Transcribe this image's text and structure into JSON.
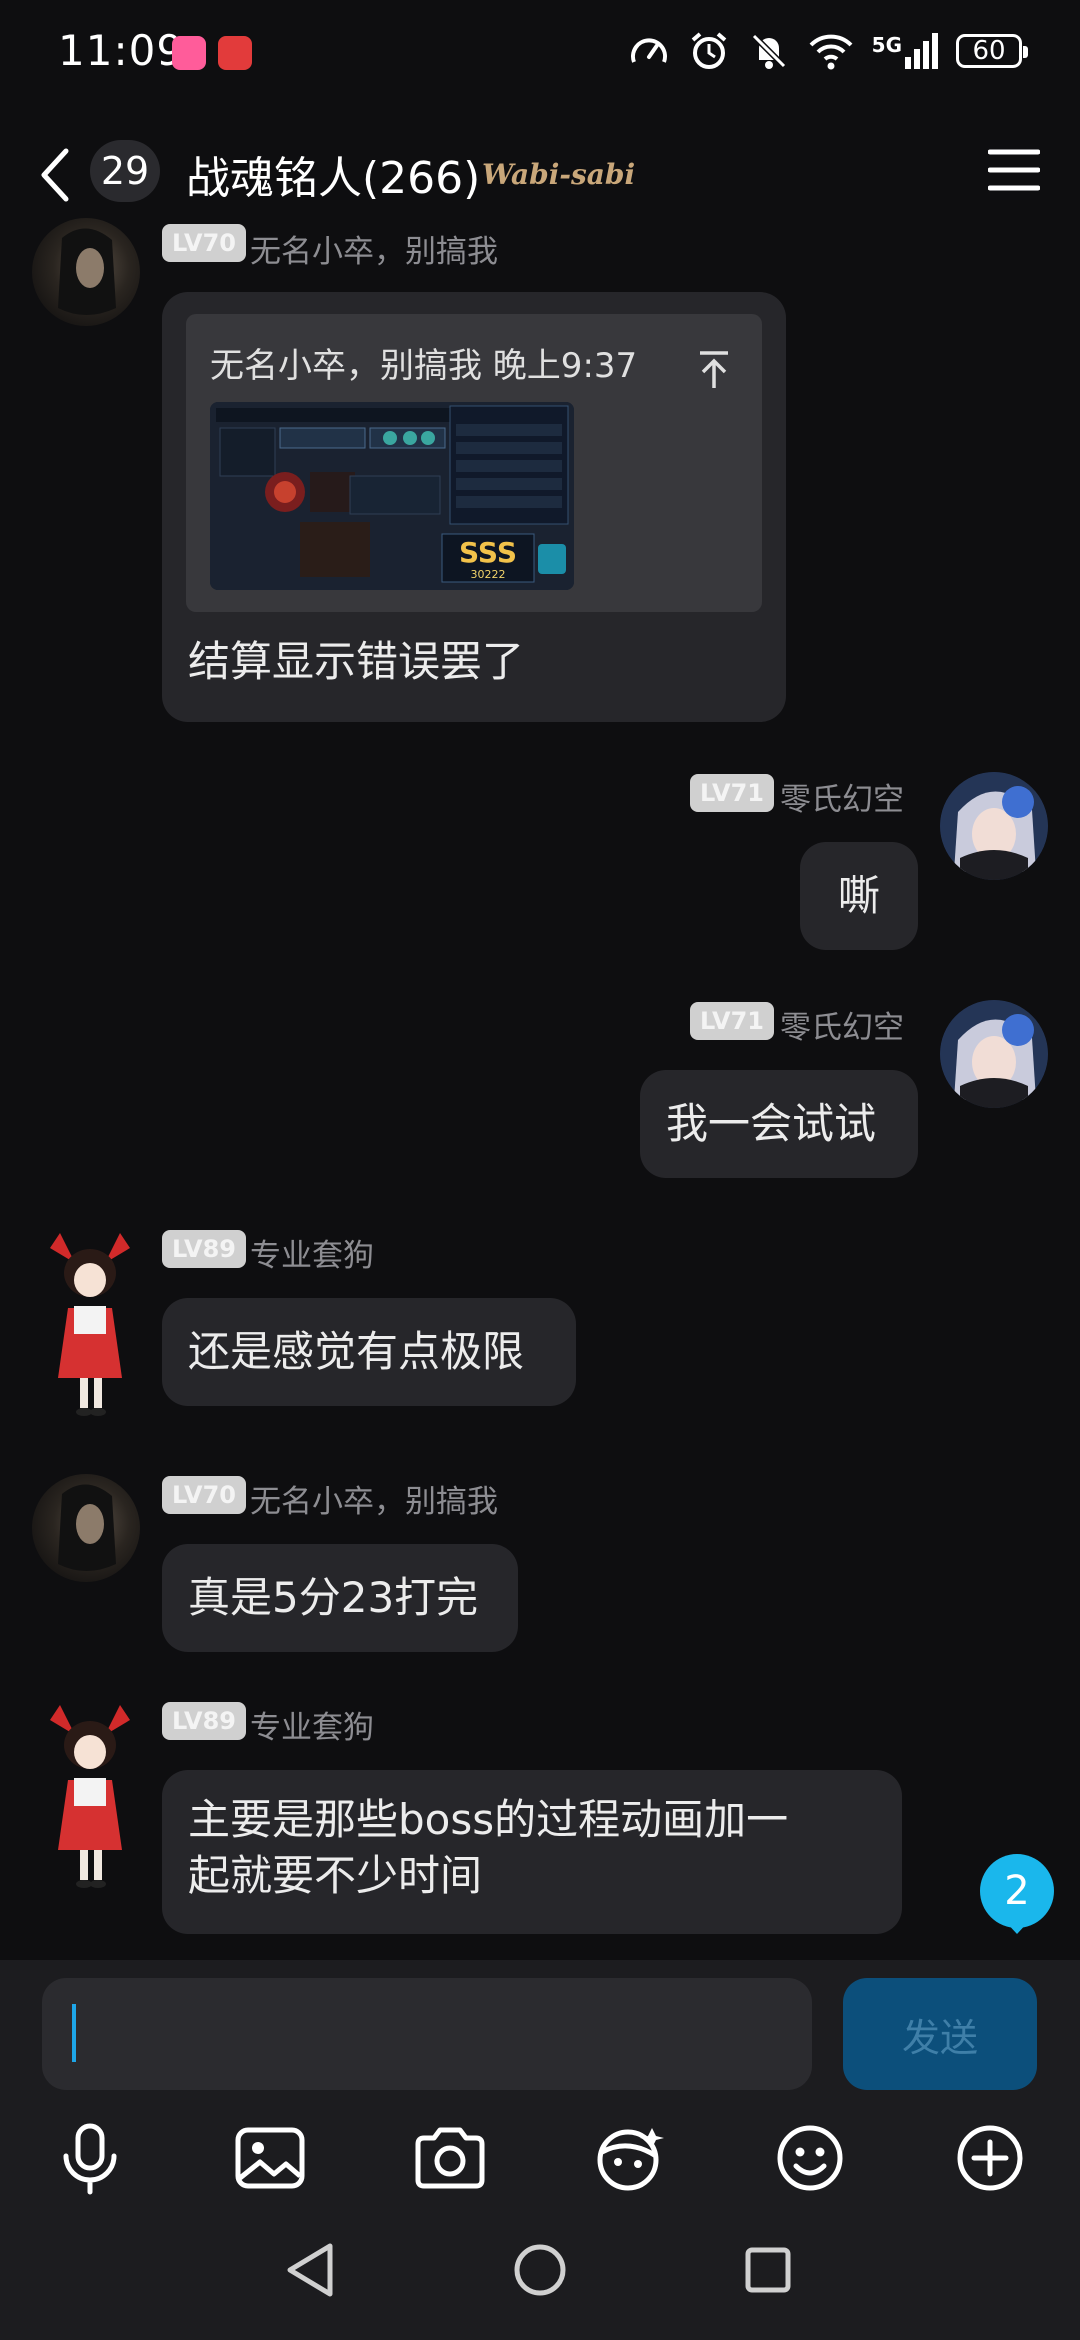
{
  "status_bar": {
    "time": "11:09",
    "network": "5G",
    "battery": "60"
  },
  "header": {
    "unread_count": "29",
    "title": "战魂铭人(266)",
    "title_decoration": "Wabi-sabi"
  },
  "messages": [
    {
      "level": "LV70",
      "sender": "无名小卒，别搞我",
      "quote_text": "无名小卒，别搞我 晚上9:37",
      "thumb_grade": "SSS",
      "thumb_score": "30222",
      "text": "结算显示错误罢了"
    },
    {
      "level": "LV71",
      "sender": "零氏幻空",
      "text": "嘶"
    },
    {
      "level": "LV71",
      "sender": "零氏幻空",
      "text": "我一会试试"
    },
    {
      "level": "LV89",
      "sender": "专业套狗",
      "text": "还是感觉有点极限"
    },
    {
      "level": "LV70",
      "sender": "无名小卒，别搞我",
      "text": "真是5分23打完"
    },
    {
      "level": "LV89",
      "sender": "专业套狗",
      "line1": "主要是那些boss的过程动画加一",
      "line2": "起就要不少时间"
    }
  ],
  "new_message_count": "2",
  "input": {
    "placeholder": "",
    "send_label": "发送"
  },
  "toolbar": [
    "microphone-icon",
    "image-icon",
    "camera-icon",
    "sticker-icon",
    "emoji-icon",
    "plus-icon"
  ],
  "colors": {
    "background": "#0e0e10",
    "bubble": "#26262a",
    "accent": "#1ab7ec",
    "send_button": "#0c4f7b"
  }
}
